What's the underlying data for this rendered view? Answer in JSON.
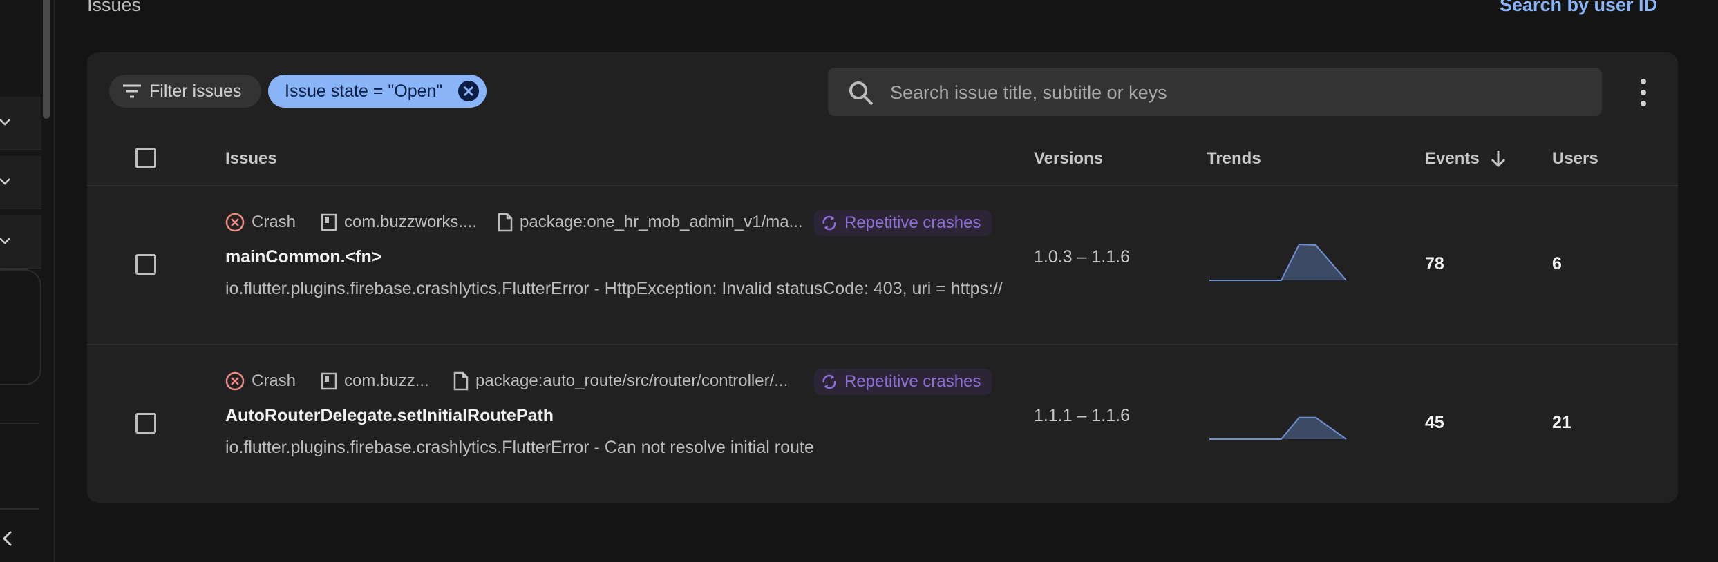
{
  "header": {
    "title": "Issues",
    "search_by_user": "Search by user ID"
  },
  "toolbar": {
    "filter_label": "Filter issues",
    "state_chip": "Issue state = \"Open\"",
    "search_placeholder": "Search issue title, subtitle or keys"
  },
  "columns": {
    "issues": "Issues",
    "versions": "Versions",
    "trends": "Trends",
    "events": "Events",
    "users": "Users"
  },
  "rows": [
    {
      "type": "Crash",
      "app": "com.buzzworks....",
      "file": "package:one_hr_mob_admin_v1/ma...",
      "badge": "Repetitive crashes",
      "title": "mainCommon.<fn>",
      "subtitle": "io.flutter.plugins.firebase.crashlytics.FlutterError - HttpException: Invalid statusCode: 403, uri = https://",
      "versions": "1.0.3 – 1.1.6",
      "events": "78",
      "users": "6",
      "trend": [
        0,
        0,
        0,
        0,
        0,
        1,
        0.98,
        0
      ]
    },
    {
      "type": "Crash",
      "app": "com.buzz...",
      "file": "package:auto_route/src/router/controller/...",
      "badge": "Repetitive crashes",
      "title": "AutoRouterDelegate.setInitialRoutePath",
      "subtitle": "io.flutter.plugins.firebase.crashlytics.FlutterError - Can not resolve initial route",
      "versions": "1.1.1 – 1.1.6",
      "events": "45",
      "users": "21",
      "trend": [
        0,
        0,
        0,
        0,
        0,
        0.6,
        0.6,
        0
      ]
    }
  ],
  "colors": {
    "accent": "#8ab4f8",
    "badge_text": "#8e6fd8",
    "crash_icon": "#f28b82",
    "trend_fill": "#3d4a66",
    "trend_line": "#6f8fd0"
  }
}
